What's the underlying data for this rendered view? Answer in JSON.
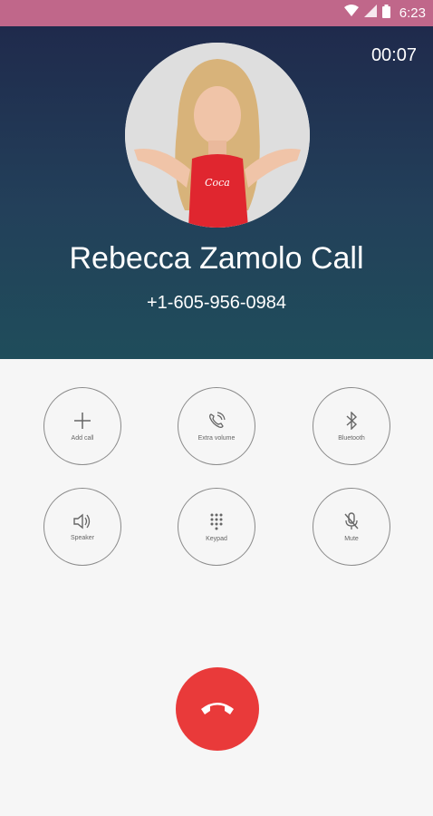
{
  "status_bar": {
    "time": "6:23",
    "icons": [
      "wifi-icon",
      "signal-icon",
      "battery-icon"
    ]
  },
  "call": {
    "timer": "00:07",
    "contact_name": "Rebecca Zamolo Call",
    "phone_number": "+1-605-956-0984"
  },
  "controls": [
    {
      "label": "Add call",
      "icon": "plus-icon"
    },
    {
      "label": "Extra volume",
      "icon": "phone-volume-icon"
    },
    {
      "label": "Bluetooth",
      "icon": "bluetooth-icon"
    },
    {
      "label": "Speaker",
      "icon": "speaker-icon"
    },
    {
      "label": "Keypad",
      "icon": "keypad-icon"
    },
    {
      "label": "Mute",
      "icon": "mic-off-icon"
    }
  ],
  "end_call": {
    "icon": "end-call-icon"
  },
  "colors": {
    "status_bar": "#c0678a",
    "header_top": "#1f2a4c",
    "header_bottom": "#1f4d5b",
    "end_call": "#e93a3a"
  }
}
